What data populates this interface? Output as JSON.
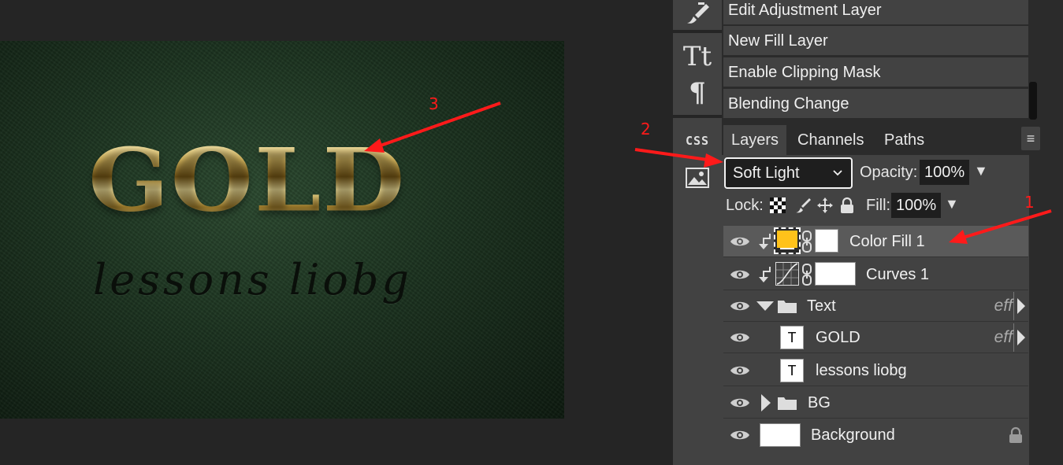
{
  "canvas": {
    "headline": "GOLD",
    "script_text": "lessons liobg"
  },
  "annotations": {
    "one": "1",
    "two": "2",
    "three": "3"
  },
  "tools": [
    "brush-icon",
    "text-tool-icon",
    "paragraph-icon",
    "css-icon",
    "image-icon"
  ],
  "tool_labels": {
    "css": "CSS"
  },
  "history": {
    "items": [
      "Edit Adjustment Layer",
      "New Fill Layer",
      "Enable Clipping Mask",
      "Blending Change"
    ]
  },
  "tabs": {
    "layers": "Layers",
    "channels": "Channels",
    "paths": "Paths"
  },
  "layers_panel": {
    "blend_mode": "Soft Light",
    "opacity_label": "Opacity:",
    "opacity_value": "100%",
    "lock_label": "Lock:",
    "fill_label": "Fill:",
    "fill_value": "100%"
  },
  "layers": [
    {
      "name": "Color Fill 1",
      "selected": true
    },
    {
      "name": "Curves 1"
    },
    {
      "name": "Text",
      "effects": "eff"
    },
    {
      "name": "GOLD",
      "effects": "eff",
      "thumb": "T"
    },
    {
      "name": "lessons liobg",
      "thumb": "T"
    },
    {
      "name": "BG"
    },
    {
      "name": "Background"
    }
  ],
  "colors": {
    "annotation_red": "#ff1a1a",
    "fill_swatch": "#ffc21a",
    "panel_bg": "#424242"
  }
}
